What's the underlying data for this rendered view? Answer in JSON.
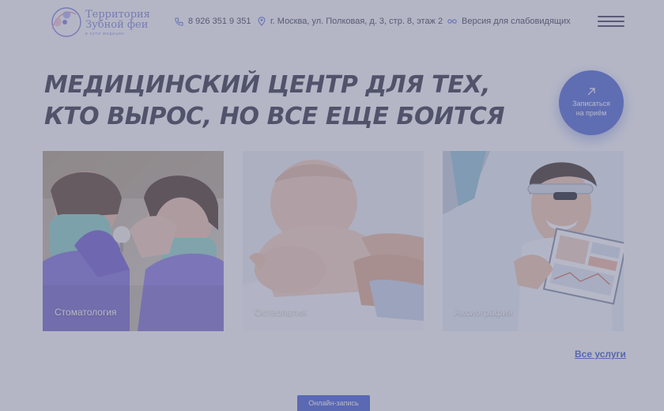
{
  "header": {
    "logo": {
      "line1": "Территория",
      "line2": "Зубной феи",
      "sub": "в кути медицин"
    },
    "phone": "8 926 351 9 351",
    "address": "г. Москва, ул. Полковая, д. 3, стр. 8, этаж 2",
    "vision_mode": "Версия для слабовидящих",
    "icons": [
      "phone-icon",
      "location-pin-icon",
      "glasses-icon",
      "menu-icon"
    ]
  },
  "hero": {
    "title_line1": "МЕДИЦИНСКИЙ ЦЕНТР ДЛЯ ТЕХ,",
    "title_line2": "КТО ВЫРОС, НО ВСЕ ЕЩЕ БОИТСЯ",
    "cta_line1": "Записаться",
    "cta_line2": "на приём"
  },
  "services": [
    {
      "label": "Стоматология"
    },
    {
      "label": "Остеопатия"
    },
    {
      "label": "Аксиография"
    }
  ],
  "all_services_link": "Все услуги",
  "online_booking_button": "Онлайн-запись",
  "colors": {
    "accent": "#4a63d6",
    "title": "#2d2d40",
    "overlay": "#737694"
  }
}
